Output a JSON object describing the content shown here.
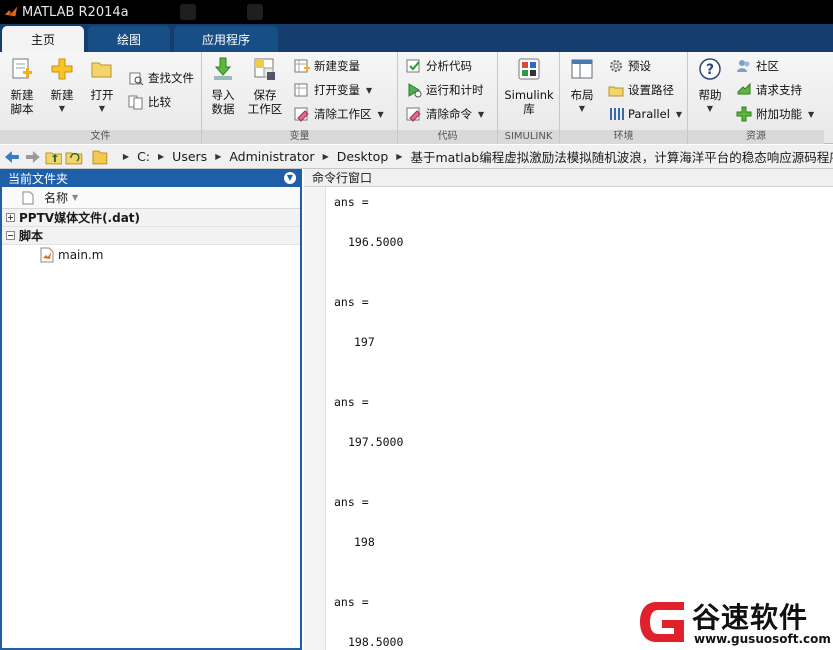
{
  "window": {
    "title": "MATLAB R2014a"
  },
  "tabs": [
    {
      "label": "主页",
      "active": true
    },
    {
      "label": "绘图",
      "active": false
    },
    {
      "label": "应用程序",
      "active": false
    }
  ],
  "ribbon": {
    "file": {
      "label": "文件",
      "new_script": "新建\n脚本",
      "new": "新建",
      "open": "打开",
      "find_files": "查找文件",
      "compare": "比较"
    },
    "variable": {
      "label": "变量",
      "import": "导入\n数据",
      "save_workspace": "保存\n工作区",
      "new_variable": "新建变量",
      "open_variable": "打开变量",
      "clear_workspace": "清除工作区"
    },
    "code": {
      "label": "代码",
      "analyze": "分析代码",
      "run_time": "运行和计时",
      "clear_commands": "清除命令"
    },
    "simulink": {
      "label": "SIMULINK",
      "library": "Simulink\n库"
    },
    "environment": {
      "label": "环境",
      "layout": "布局",
      "preferences": "预设",
      "set_path": "设置路径",
      "parallel": "Parallel"
    },
    "resources": {
      "label": "资源",
      "help": "帮助",
      "community": "社区",
      "request_support": "请求支持",
      "addons": "附加功能"
    }
  },
  "address": {
    "path": [
      "C:",
      "Users",
      "Administrator",
      "Desktop",
      "基于matlab编程虚拟激励法模拟随机波浪，计算海洋平台的稳态响应源码程序"
    ]
  },
  "current_folder": {
    "title": "当前文件夹",
    "column_name": "名称",
    "groups": [
      {
        "label": "PPTV媒体文件(.dat)",
        "expanded": false,
        "items": []
      },
      {
        "label": "脚本",
        "expanded": true,
        "items": [
          "main.m"
        ]
      }
    ]
  },
  "command_window": {
    "title": "命令行窗口",
    "entries": [
      {
        "label": "ans =",
        "value": "196.5000"
      },
      {
        "label": "ans =",
        "value": "197"
      },
      {
        "label": "ans =",
        "value": "197.5000"
      },
      {
        "label": "ans =",
        "value": "198"
      },
      {
        "label": "ans =",
        "value": "198.5000"
      }
    ]
  },
  "watermark": {
    "text": "谷速软件",
    "url": "www.gusuosoft.com"
  },
  "colors": {
    "tab_strip": "#143c6c",
    "panel_border": "#1f5fa8",
    "watermark_red": "#e0212b"
  }
}
